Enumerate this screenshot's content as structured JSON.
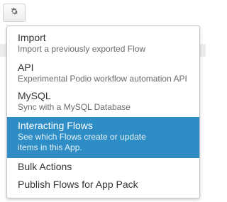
{
  "toolbar": {
    "gear_icon": "gear-icon"
  },
  "colors": {
    "active_background": "#2e8dc4",
    "menu_border": "#bfc3c7",
    "text_primary": "#333333",
    "text_secondary": "#6b6b6b"
  },
  "menu": {
    "items": [
      {
        "title": "Import",
        "desc": "Import a previously exported Flow"
      },
      {
        "title": "API",
        "desc": "Experimental Podio workflow automation API"
      },
      {
        "title": "MySQL",
        "desc": "Sync with a MySQL Database"
      },
      {
        "title": "Interacting Flows",
        "desc": "See which Flows create or update items in this App.",
        "active": true
      },
      {
        "title": "Bulk Actions"
      },
      {
        "title": "Publish Flows for App Pack"
      }
    ]
  }
}
